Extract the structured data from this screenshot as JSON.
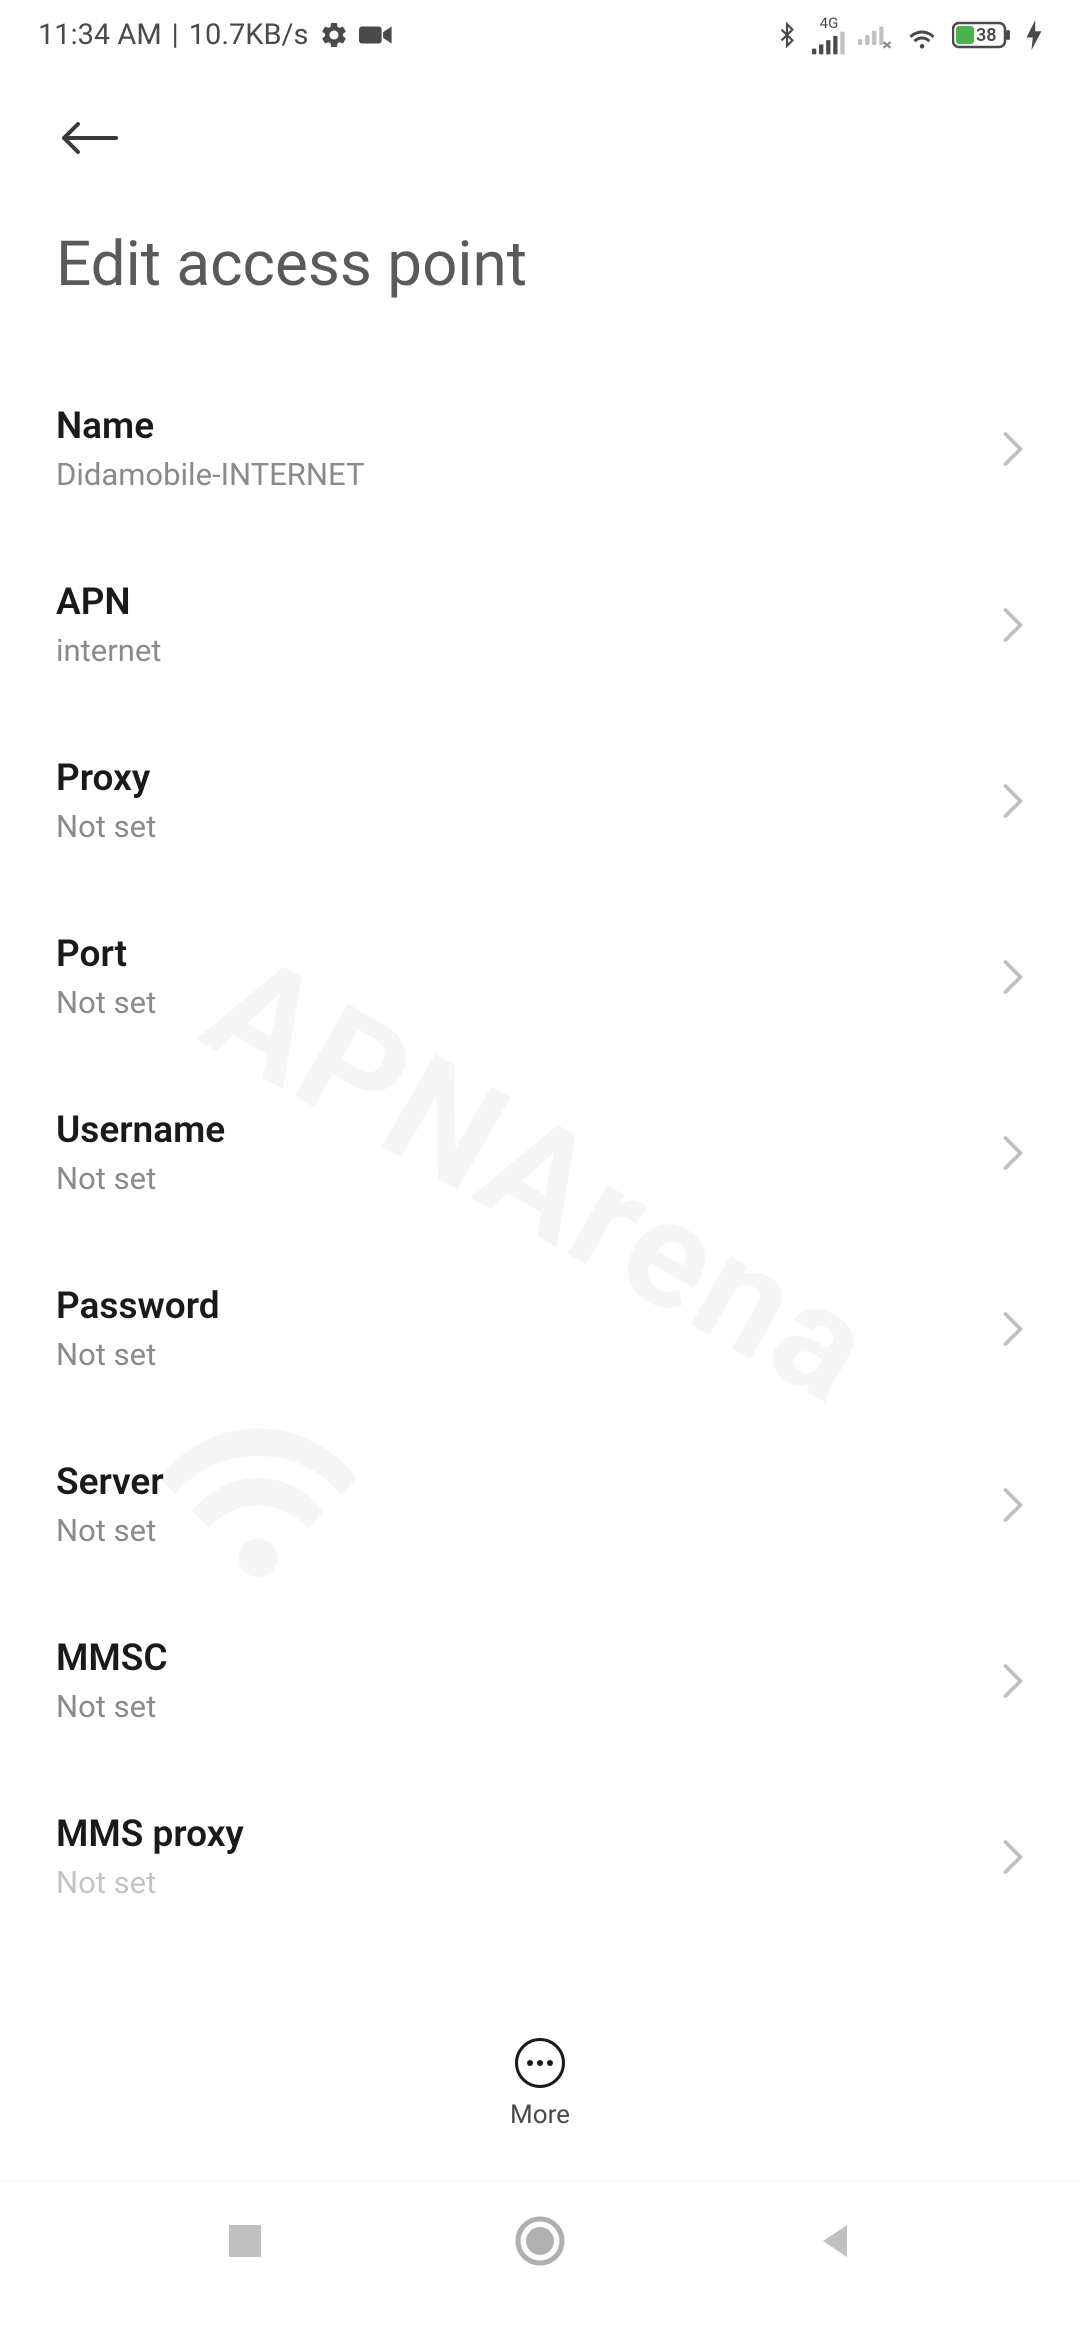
{
  "status": {
    "time": "11:34 AM",
    "speed": "10.7KB/s",
    "battery": "38",
    "network_label": "4G"
  },
  "page": {
    "title": "Edit access point"
  },
  "settings": [
    {
      "label": "Name",
      "value": "Didamobile-INTERNET"
    },
    {
      "label": "APN",
      "value": "internet"
    },
    {
      "label": "Proxy",
      "value": "Not set"
    },
    {
      "label": "Port",
      "value": "Not set"
    },
    {
      "label": "Username",
      "value": "Not set"
    },
    {
      "label": "Password",
      "value": "Not set"
    },
    {
      "label": "Server",
      "value": "Not set"
    },
    {
      "label": "MMSC",
      "value": "Not set"
    },
    {
      "label": "MMS proxy",
      "value": "Not set"
    }
  ],
  "bottom": {
    "more_label": "More"
  },
  "watermark": "APNArena"
}
